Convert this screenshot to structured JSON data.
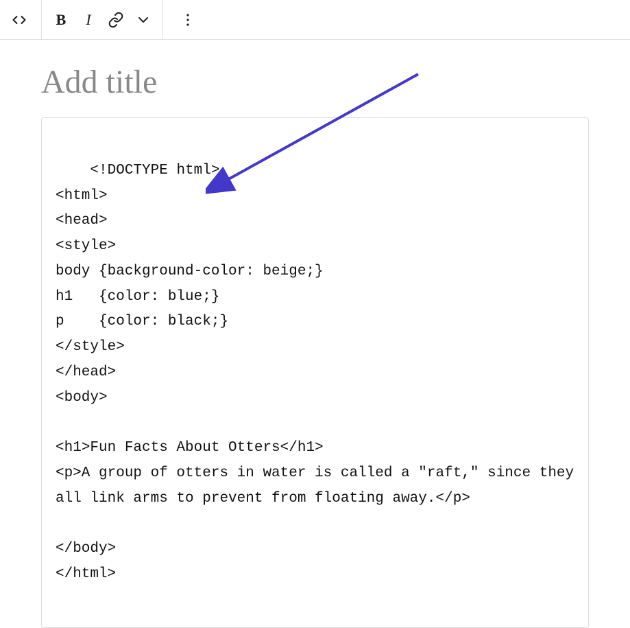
{
  "toolbar": {
    "bold_label": "B",
    "italic_label": "I"
  },
  "title": {
    "placeholder": "Add title",
    "value": ""
  },
  "code_block": {
    "content": "<!DOCTYPE html>\n<html>\n<head>\n<style>\nbody {background-color: beige;}\nh1   {color: blue;}\np    {color: black;}\n</style>\n</head>\n<body>\n\n<h1>Fun Facts About Otters</h1>\n<p>A group of otters in water is called a \"raft,\" since they all link arms to prevent from floating away.</p>\n\n</body>\n</html>"
  },
  "annotation": {
    "arrow_color": "#4338ca"
  }
}
